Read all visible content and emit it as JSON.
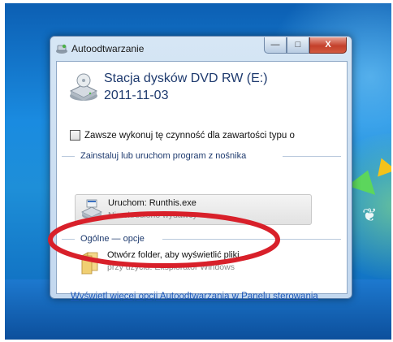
{
  "window": {
    "title": "Autoodtwarzanie",
    "drive_name": "Stacja dysków DVD RW (E:)",
    "drive_date": "2011-11-03",
    "always_checkbox_label": "Zawsze wykonuj tę czynność dla zawartości typu o",
    "always_checked": false
  },
  "install_section": {
    "header": "Zainstaluj lub uruchom program z nośnika",
    "option": {
      "title": "Uruchom: Runthis.exe",
      "subtitle": "Nie określono wydawcy"
    }
  },
  "general_section": {
    "header": "Ogólne — opcje",
    "option": {
      "title": "Otwórz folder, aby wyświetlić pliki",
      "subtitle": "przy użyciu: Eksplorator Windows"
    }
  },
  "panel_link": "Wyświetl więcej opcji Autoodtwarzania w Panelu sterowania",
  "colors": {
    "highlight_ellipse": "#d8202a",
    "desktop": "#1a8be0",
    "link": "#1a56b8"
  },
  "icons": {
    "title": "autoplay-icon",
    "drive": "dvd-drive-icon",
    "runthis": "program-drive-icon",
    "folder": "folder-icon"
  }
}
